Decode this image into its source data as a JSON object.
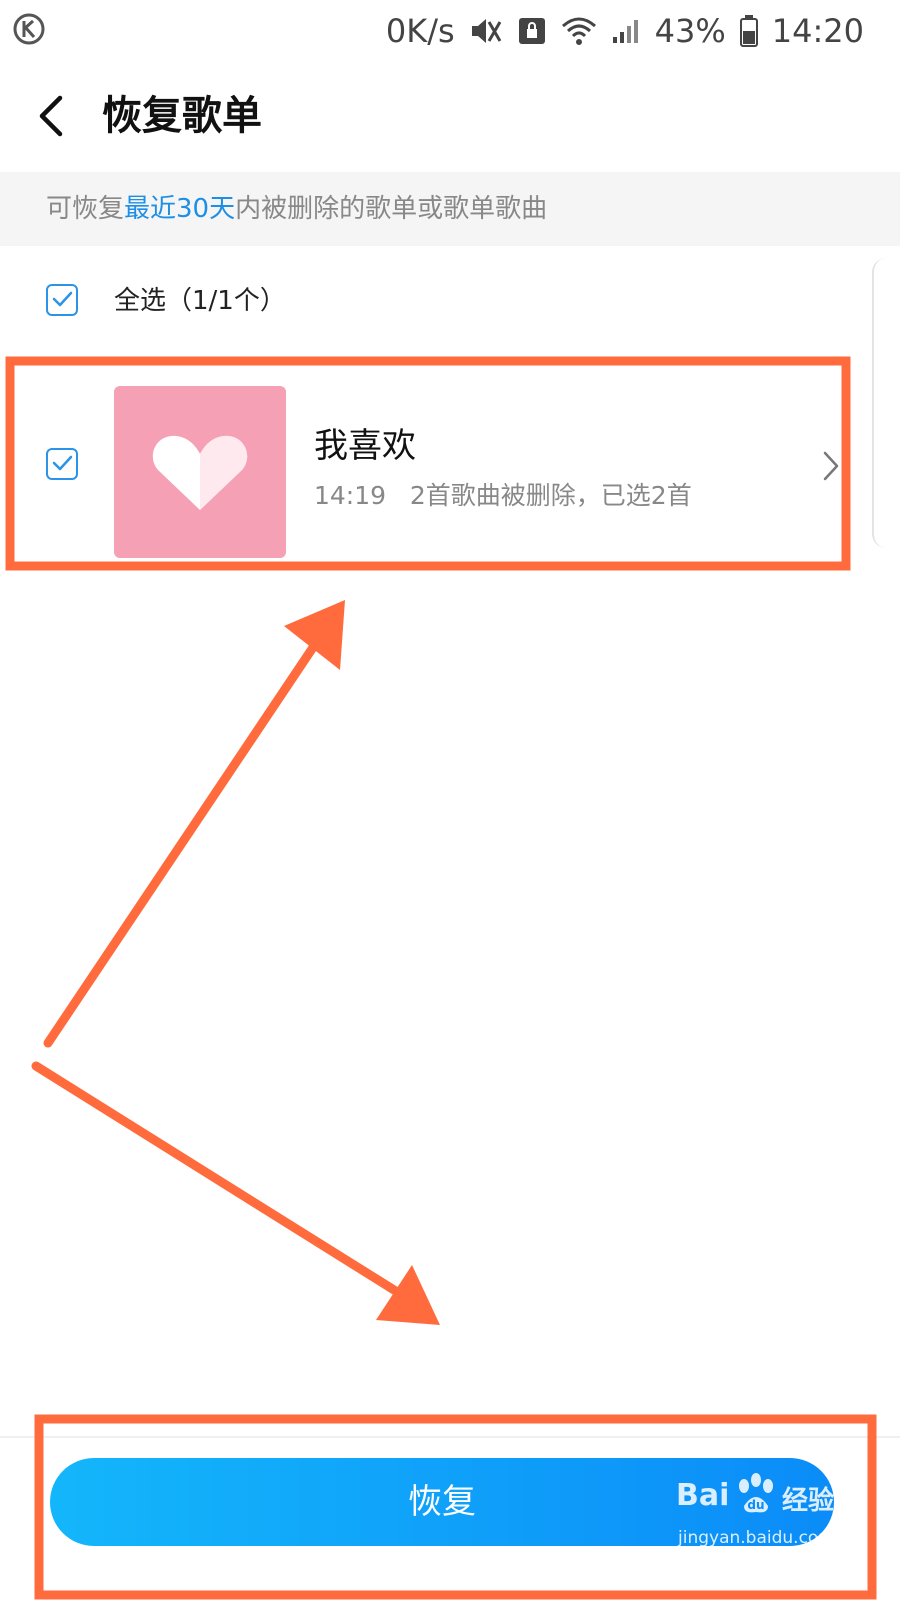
{
  "status_bar": {
    "net_speed": "0K/s",
    "battery": "43%",
    "time": "14:20"
  },
  "header": {
    "title": "恢复歌单"
  },
  "info_banner": {
    "prefix": "可恢复",
    "highlight": "最近30天",
    "suffix": "内被删除的歌单或歌单歌曲",
    "highlight_color": "#1e8fe6"
  },
  "select_all": {
    "label": "全选（1/1个）",
    "checked": true
  },
  "playlists": [
    {
      "name": "我喜欢",
      "time": "14:19",
      "detail": "2首歌曲被删除，已选2首",
      "checked": true,
      "cover_color": "#f6a0b6"
    }
  ],
  "footer": {
    "restore_label": "恢复",
    "button_color": "#0b8cf8"
  },
  "watermark": {
    "brand": "Bai",
    "brand2": "经验",
    "url": "jingyan.baidu.com"
  },
  "annotation_color": "#ff6b3d"
}
